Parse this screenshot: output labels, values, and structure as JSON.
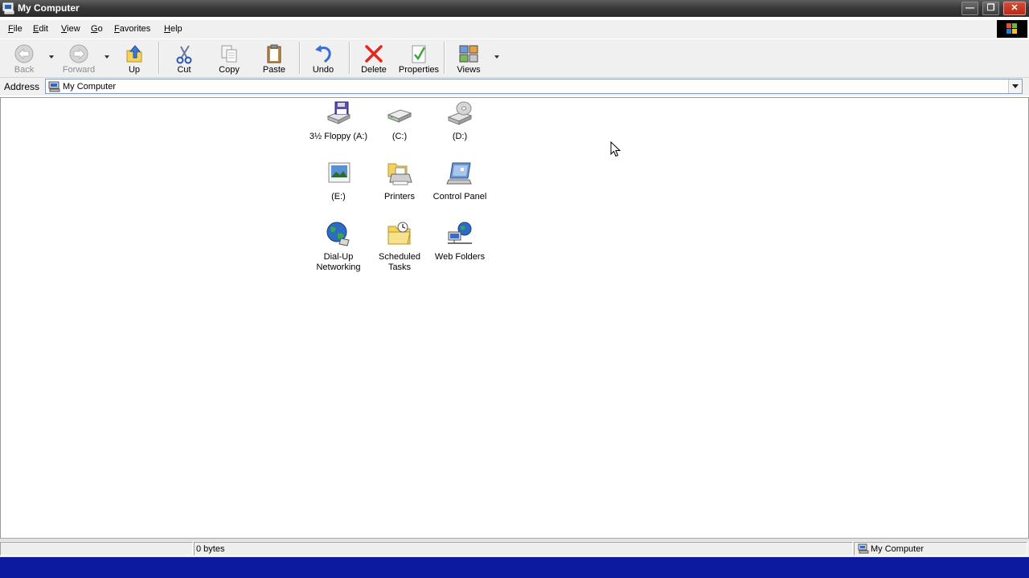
{
  "window": {
    "title": "My Computer",
    "min_glyph": "—",
    "max_glyph": "❐",
    "close_glyph": "✕"
  },
  "menu": [
    {
      "label": "File"
    },
    {
      "label": "Edit"
    },
    {
      "label": "View"
    },
    {
      "label": "Go"
    },
    {
      "label": "Favorites"
    },
    {
      "label": "Help"
    }
  ],
  "toolbar": {
    "back": "Back",
    "forward": "Forward",
    "up": "Up",
    "cut": "Cut",
    "copy": "Copy",
    "paste": "Paste",
    "undo": "Undo",
    "delete": "Delete",
    "properties": "Properties",
    "views": "Views"
  },
  "address": {
    "label": "Address",
    "value": "My Computer"
  },
  "items": [
    {
      "label": "3½ Floppy (A:)",
      "icon": "floppy-drive-icon"
    },
    {
      "label": "(C:)",
      "icon": "hard-drive-icon"
    },
    {
      "label": "(D:)",
      "icon": "cd-drive-icon"
    },
    {
      "label": "(E:)",
      "icon": "removable-drive-icon"
    },
    {
      "label": "Printers",
      "icon": "printers-folder-icon"
    },
    {
      "label": "Control Panel",
      "icon": "control-panel-icon"
    },
    {
      "label": "Dial-Up Networking",
      "icon": "dial-up-networking-icon"
    },
    {
      "label": "Scheduled Tasks",
      "icon": "scheduled-tasks-icon"
    },
    {
      "label": "Web Folders",
      "icon": "web-folders-icon"
    }
  ],
  "status": {
    "size": "0 bytes",
    "zone": "My Computer"
  },
  "colors": {
    "taskbar": "#0c1aa0",
    "titlebar": "#3a3a3a",
    "close_button": "#c83a28"
  }
}
